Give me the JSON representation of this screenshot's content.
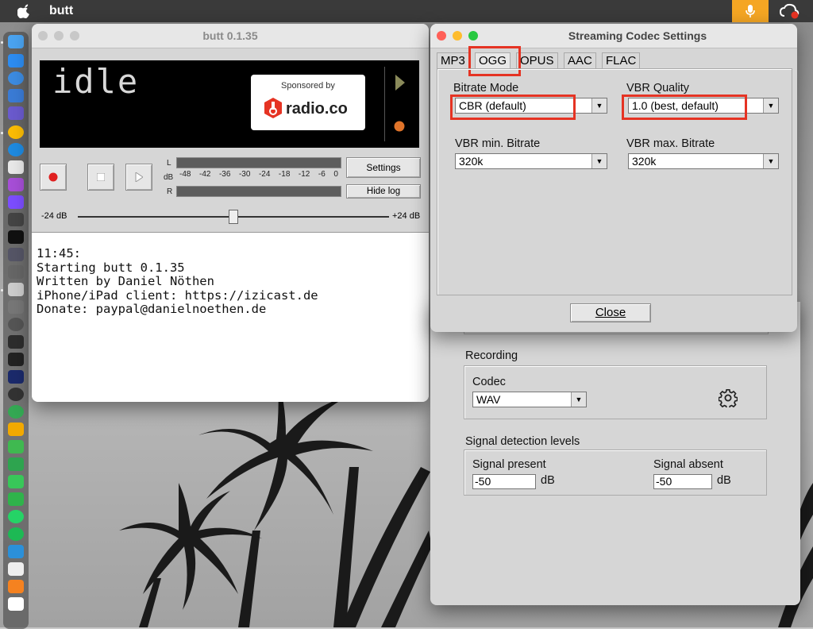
{
  "menubar": {
    "app_name": "butt"
  },
  "butt_window": {
    "title": "butt 0.1.35",
    "lcd_text": "idle",
    "sponsor": {
      "line1": "Sponsored by",
      "brand": "radio.co"
    },
    "buttons": {
      "settings": "Settings",
      "hide_log": "Hide log"
    },
    "meter": {
      "left_label": "L",
      "db_label": "dB",
      "right_label": "R",
      "ticks": [
        "-48",
        "-42",
        "-36",
        "-30",
        "-24",
        "-18",
        "-12",
        "-6",
        "0"
      ]
    },
    "gain": {
      "min_label": "-24 dB",
      "max_label": "+24 dB",
      "value_fraction": 0.5
    },
    "log_lines": [
      "11:45:",
      "Starting butt 0.1.35",
      "Written by Daniel Nöthen",
      "iPhone/iPad client: https://izicast.de",
      "Donate: paypal@danielnoethen.de"
    ]
  },
  "codec_dialog": {
    "title": "Streaming Codec Settings",
    "tabs": [
      "MP3",
      "OGG",
      "OPUS",
      "AAC",
      "FLAC"
    ],
    "active_tab": "OGG",
    "bitrate_mode": {
      "label": "Bitrate Mode",
      "value": "CBR (default)"
    },
    "vbr_quality": {
      "label": "VBR Quality",
      "value": "1.0 (best, default)"
    },
    "vbr_min": {
      "label": "VBR min. Bitrate",
      "value": "320k"
    },
    "vbr_max": {
      "label": "VBR max. Bitrate",
      "value": "320k"
    },
    "close_label": "Close"
  },
  "settings_back": {
    "recording_heading": "Recording",
    "codec_label": "Codec",
    "codec_value": "WAV",
    "signal_heading": "Signal detection levels",
    "signal_present_label": "Signal present",
    "signal_present_value": "-50",
    "signal_absent_label": "Signal absent",
    "signal_absent_value": "-50",
    "db_unit": "dB"
  },
  "colors": {
    "highlight": "#e53323",
    "record_red": "#e02020",
    "mic_orange": "#f5a623"
  }
}
